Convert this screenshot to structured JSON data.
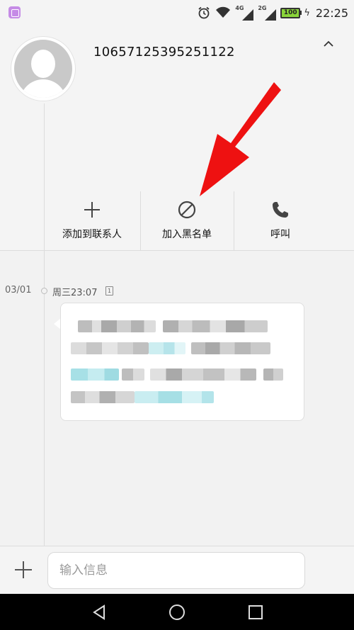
{
  "status_bar": {
    "net_4g": "4G",
    "net_2g": "2G",
    "battery": "100",
    "time": "22:25"
  },
  "contact": {
    "number": "10657125395251122"
  },
  "actions": [
    {
      "label": "添加到联系人",
      "icon": "plus-icon"
    },
    {
      "label": "加入黑名单",
      "icon": "block-icon"
    },
    {
      "label": "呼叫",
      "icon": "phone-icon"
    }
  ],
  "conversation": {
    "date": "03/01",
    "time": "周三23:07",
    "sim": "1"
  },
  "composer": {
    "placeholder": "输入信息"
  },
  "colors": {
    "annotation_arrow": "#ee1111",
    "battery_fill": "#8ad53a",
    "blur_teal": "#a7e0e6"
  }
}
